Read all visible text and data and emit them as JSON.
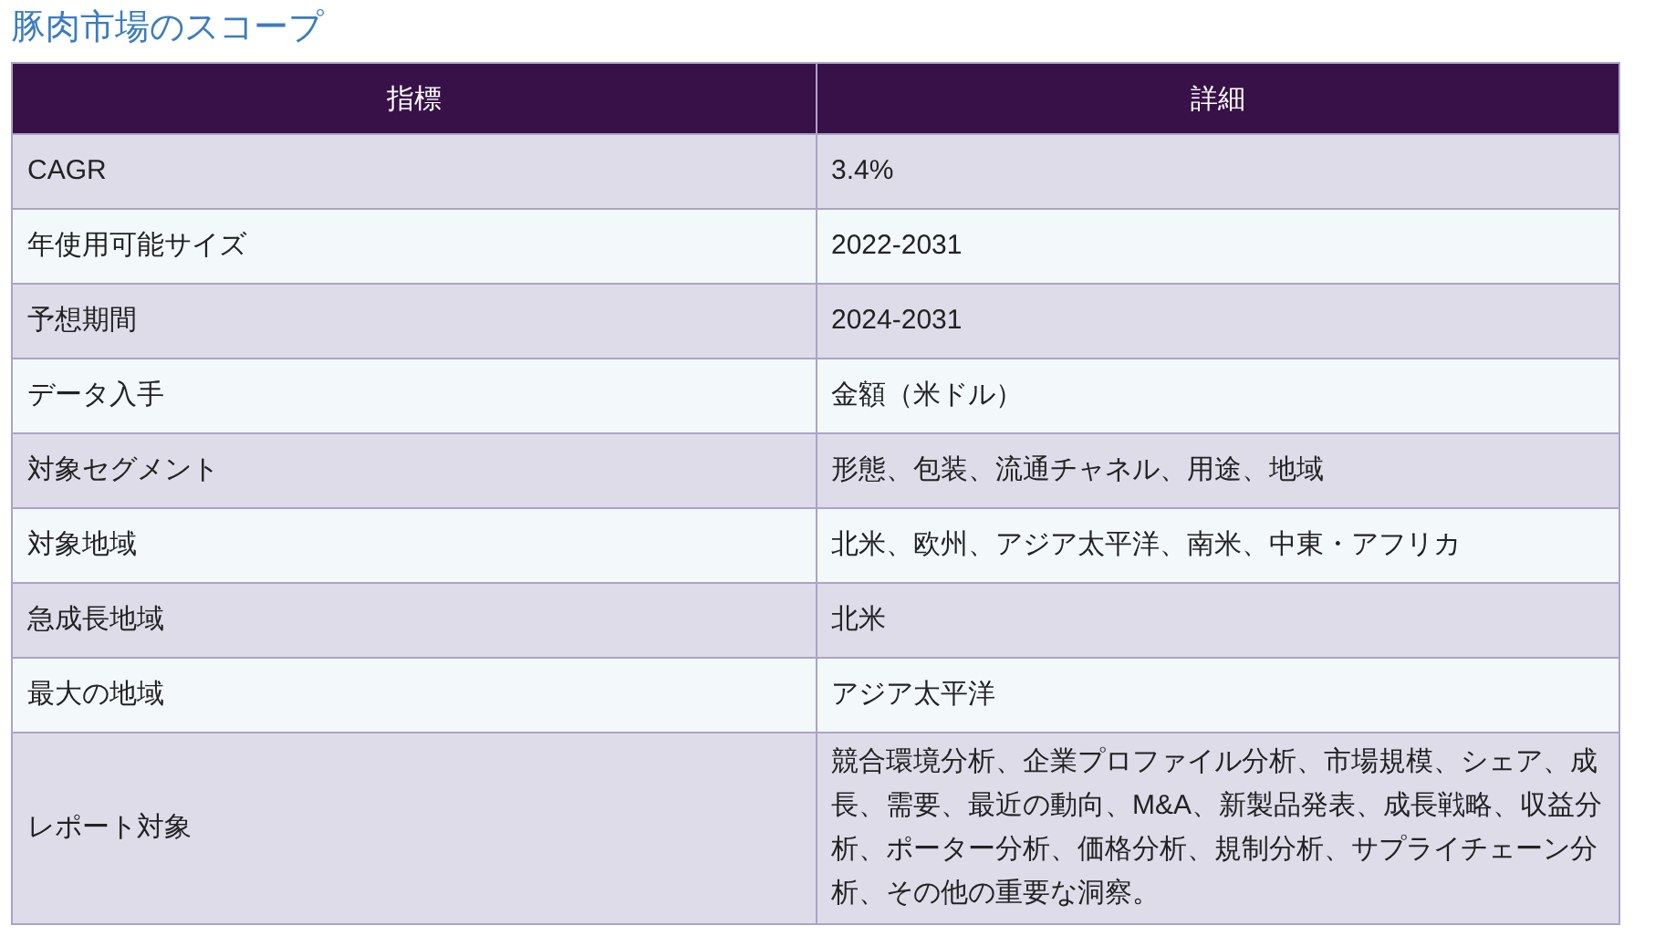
{
  "title": "豚肉市場のスコープ",
  "table": {
    "columns": [
      "指標",
      "詳細"
    ],
    "rows": [
      [
        "CAGR",
        "3.4%"
      ],
      [
        "年使用可能サイズ",
        "2022-2031"
      ],
      [
        "予想期間",
        "2024-2031"
      ],
      [
        "データ入手",
        "金額（米ドル）"
      ],
      [
        "対象セグメント",
        "形態、包装、流通チャネル、用途、地域"
      ],
      [
        "対象地域",
        "北米、欧州、アジア太平洋、南米、中東・アフリカ"
      ],
      [
        "急成長地域",
        "北米"
      ],
      [
        "最大の地域",
        "アジア太平洋"
      ],
      [
        "レポート対象",
        "競合環境分析、企業プロファイル分析、市場規模、シェア、成長、需要、最近の動向、M&A、新製品発表、成長戦略、収益分析、ポーター分析、価格分析、規制分析、サプライチェーン分析、その他の重要な洞察。"
      ]
    ]
  }
}
